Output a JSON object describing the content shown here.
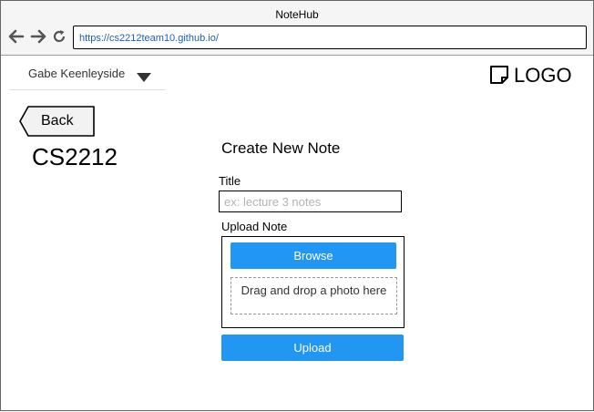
{
  "browser": {
    "window_title": "NoteHub",
    "url": "https://cs2212team10.github.io/",
    "icons": [
      "back-arrow-icon",
      "forward-arrow-icon",
      "reload-icon"
    ]
  },
  "header": {
    "user_name": "Gabe Keenleyside",
    "logo_text": "LOGO",
    "logo_icon": "sticky-note-icon"
  },
  "page": {
    "back_label": "Back",
    "course_code": "CS2212"
  },
  "form": {
    "heading": "Create New Note",
    "title_label": "Title",
    "title_placeholder": "ex: lecture 3 notes",
    "upload_label": "Upload Note",
    "browse_label": "Browse",
    "drop_text": "Drag and drop a photo here",
    "upload_button_label": "Upload"
  },
  "colors": {
    "accent": "#2196f3"
  }
}
